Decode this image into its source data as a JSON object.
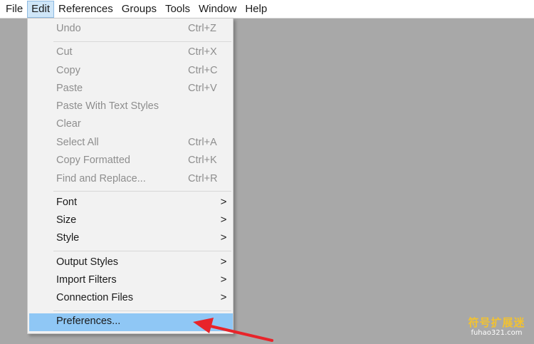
{
  "menubar": {
    "items": [
      {
        "label": "File",
        "active": false
      },
      {
        "label": "Edit",
        "active": true
      },
      {
        "label": "References",
        "active": false
      },
      {
        "label": "Groups",
        "active": false
      },
      {
        "label": "Tools",
        "active": false
      },
      {
        "label": "Window",
        "active": false
      },
      {
        "label": "Help",
        "active": false
      }
    ]
  },
  "edit_menu": {
    "undo": {
      "label": "Undo",
      "shortcut": "Ctrl+Z",
      "enabled": false
    },
    "cut": {
      "label": "Cut",
      "shortcut": "Ctrl+X",
      "enabled": false
    },
    "copy": {
      "label": "Copy",
      "shortcut": "Ctrl+C",
      "enabled": false
    },
    "paste": {
      "label": "Paste",
      "shortcut": "Ctrl+V",
      "enabled": false
    },
    "paste_with_text_styles": {
      "label": "Paste With Text Styles",
      "enabled": false
    },
    "clear": {
      "label": "Clear",
      "enabled": false
    },
    "select_all": {
      "label": "Select All",
      "shortcut": "Ctrl+A",
      "enabled": false
    },
    "copy_formatted": {
      "label": "Copy Formatted",
      "shortcut": "Ctrl+K",
      "enabled": false
    },
    "find_and_replace": {
      "label": "Find and Replace...",
      "shortcut": "Ctrl+R",
      "enabled": false
    },
    "font": {
      "label": "Font",
      "submenu_icon": "chevron-right-icon"
    },
    "size": {
      "label": "Size",
      "submenu_icon": "chevron-right-icon"
    },
    "style": {
      "label": "Style",
      "submenu_icon": "chevron-right-icon"
    },
    "output_styles": {
      "label": "Output Styles",
      "submenu_icon": "chevron-right-icon"
    },
    "import_filters": {
      "label": "Import Filters",
      "submenu_icon": "chevron-right-icon"
    },
    "connection_files": {
      "label": "Connection Files",
      "submenu_icon": "chevron-right-icon"
    },
    "preferences": {
      "label": "Preferences...",
      "highlighted": true
    }
  },
  "chevron_glyph": ">",
  "annotation": {
    "icon": "red-arrow-icon",
    "color": "#e8242a"
  },
  "watermark": {
    "chinese": "符号扩展迷",
    "url": "fuhao321.com",
    "color": "#f2c230"
  },
  "colors": {
    "background": "#a8a8a8",
    "menu_background": "#f2f2f2",
    "highlight": "#8fc7f5",
    "disabled_text": "#8e8e8e"
  }
}
